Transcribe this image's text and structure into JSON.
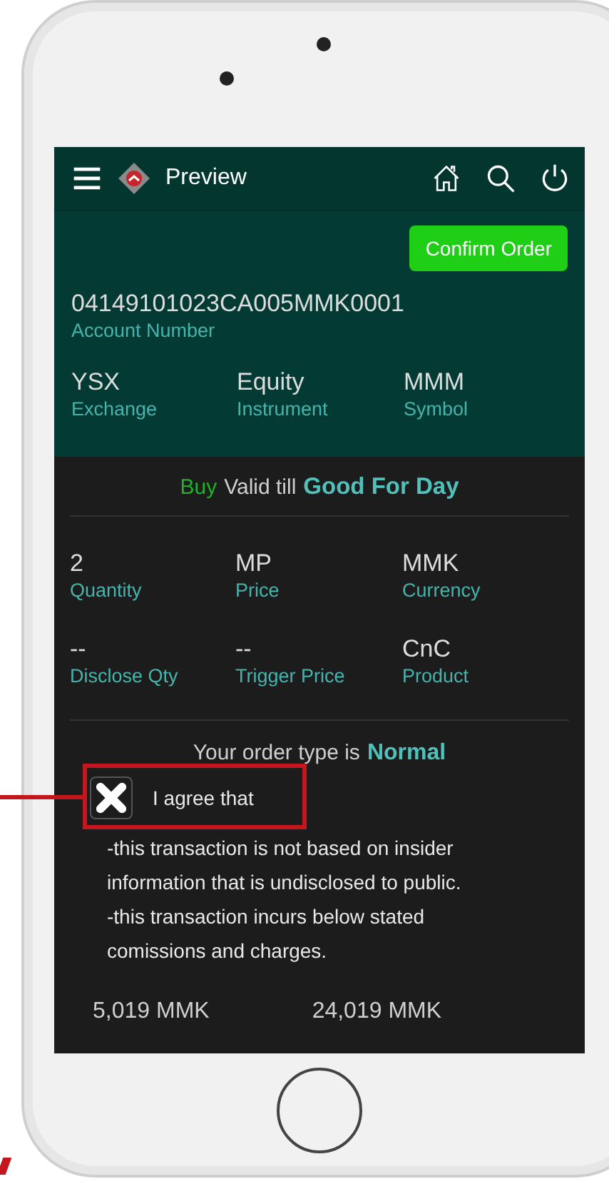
{
  "header": {
    "title": "Preview"
  },
  "confirm_button": "Confirm Order",
  "account": {
    "value": "04149101023CA005MMK0001",
    "label": "Account Number"
  },
  "instrument_fields": [
    {
      "value": "YSX",
      "label": "Exchange"
    },
    {
      "value": "Equity",
      "label": "Instrument"
    },
    {
      "value": "MMM",
      "label": "Symbol"
    }
  ],
  "validity": {
    "side": "Buy",
    "text": "Valid till",
    "value": "Good For Day"
  },
  "order_fields": [
    {
      "value": "2",
      "label": "Quantity"
    },
    {
      "value": "MP",
      "label": "Price"
    },
    {
      "value": "MMK",
      "label": "Currency"
    },
    {
      "value": "--",
      "label": "Disclose Qty"
    },
    {
      "value": "--",
      "label": "Trigger Price"
    },
    {
      "value": "CnC",
      "label": "Product"
    }
  ],
  "order_type": {
    "text": "Your order type is",
    "value": "Normal"
  },
  "agreement": {
    "label": "I agree that",
    "checked": true,
    "terms": [
      "-this transaction is not based on insider information that is undisclosed to public.",
      "-this transaction incurs below stated comissions and charges."
    ]
  },
  "amounts": [
    "5,019 MMK",
    "24,019 MMK"
  ]
}
